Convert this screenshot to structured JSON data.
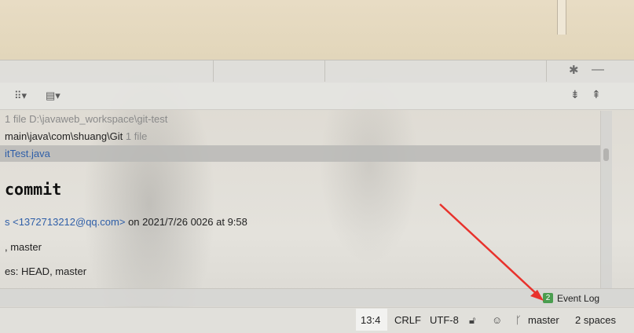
{
  "tree": {
    "row1": {
      "count": "1 file",
      "path": "D:\\javaweb_workspace\\git-test"
    },
    "row2": {
      "path": "main\\java\\com\\shuang\\Git",
      "count": "1 file"
    },
    "row3": {
      "file": "itTest.java"
    }
  },
  "details": {
    "title": "commit",
    "author_email": "s <1372713212@qq.com>",
    "date_text": "on 2021/7/26 0026 at 9:58",
    "branch_line": ", master",
    "refs_line": "es: HEAD, master"
  },
  "event_log": {
    "badge": "2",
    "label": "Event Log"
  },
  "status": {
    "position": "13:4",
    "line_sep": "CRLF",
    "encoding": "UTF-8",
    "branch": "master",
    "indent": "2 spaces"
  },
  "icons": {
    "gear": "gear-icon",
    "minimize": "minimize-icon",
    "lock": "lock-icon",
    "inspector": "inspector-icon",
    "branch": "branch-icon",
    "expand_all": "expand-all-icon",
    "collapse_all": "collapse-all-icon"
  },
  "colors": {
    "accent_link": "#2f5fa8",
    "badge_green": "#4a9d4f",
    "arrow_red": "#e8322c"
  }
}
